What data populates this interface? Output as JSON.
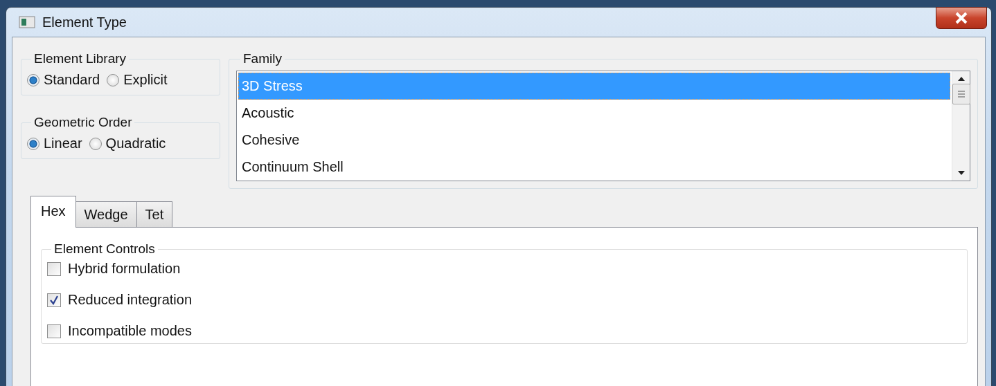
{
  "window": {
    "title": "Element Type"
  },
  "element_library": {
    "title": "Element Library",
    "options": [
      {
        "label": "Standard",
        "selected": true
      },
      {
        "label": "Explicit",
        "selected": false
      }
    ]
  },
  "geometric_order": {
    "title": "Geometric Order",
    "options": [
      {
        "label": "Linear",
        "selected": true
      },
      {
        "label": "Quadratic",
        "selected": false
      }
    ]
  },
  "family": {
    "title": "Family",
    "items": [
      {
        "label": "3D Stress",
        "selected": true
      },
      {
        "label": "Acoustic",
        "selected": false
      },
      {
        "label": "Cohesive",
        "selected": false
      },
      {
        "label": "Continuum Shell",
        "selected": false
      }
    ]
  },
  "tabs": [
    {
      "label": "Hex",
      "selected": true
    },
    {
      "label": "Wedge",
      "selected": false
    },
    {
      "label": "Tet",
      "selected": false
    }
  ],
  "element_controls": {
    "title": "Element Controls",
    "options": [
      {
        "label": "Hybrid formulation",
        "checked": false
      },
      {
        "label": "Reduced integration",
        "checked": true
      },
      {
        "label": "Incompatible modes",
        "checked": false
      }
    ]
  }
}
